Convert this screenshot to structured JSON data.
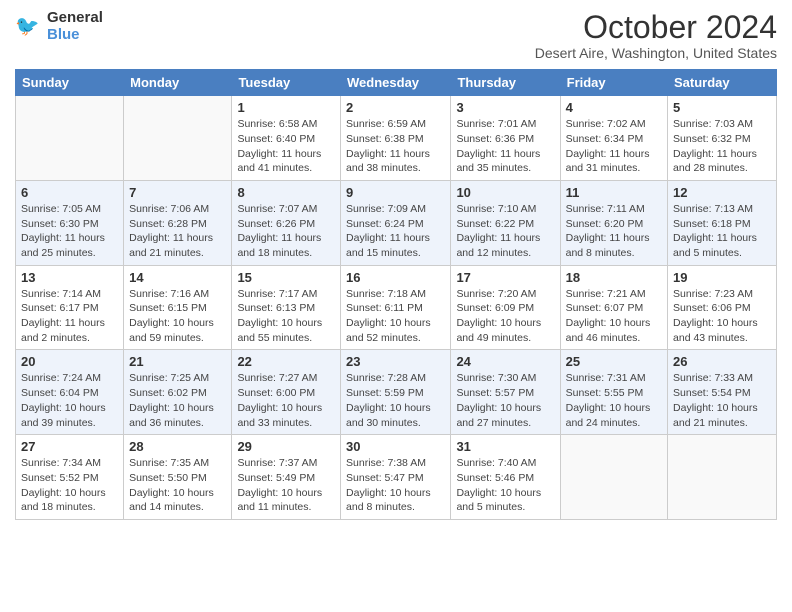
{
  "header": {
    "logo_line1": "General",
    "logo_line2": "Blue",
    "month": "October 2024",
    "location": "Desert Aire, Washington, United States"
  },
  "days_of_week": [
    "Sunday",
    "Monday",
    "Tuesday",
    "Wednesday",
    "Thursday",
    "Friday",
    "Saturday"
  ],
  "weeks": [
    [
      {
        "day": "",
        "info": ""
      },
      {
        "day": "",
        "info": ""
      },
      {
        "day": "1",
        "info": "Sunrise: 6:58 AM\nSunset: 6:40 PM\nDaylight: 11 hours and 41 minutes."
      },
      {
        "day": "2",
        "info": "Sunrise: 6:59 AM\nSunset: 6:38 PM\nDaylight: 11 hours and 38 minutes."
      },
      {
        "day": "3",
        "info": "Sunrise: 7:01 AM\nSunset: 6:36 PM\nDaylight: 11 hours and 35 minutes."
      },
      {
        "day": "4",
        "info": "Sunrise: 7:02 AM\nSunset: 6:34 PM\nDaylight: 11 hours and 31 minutes."
      },
      {
        "day": "5",
        "info": "Sunrise: 7:03 AM\nSunset: 6:32 PM\nDaylight: 11 hours and 28 minutes."
      }
    ],
    [
      {
        "day": "6",
        "info": "Sunrise: 7:05 AM\nSunset: 6:30 PM\nDaylight: 11 hours and 25 minutes."
      },
      {
        "day": "7",
        "info": "Sunrise: 7:06 AM\nSunset: 6:28 PM\nDaylight: 11 hours and 21 minutes."
      },
      {
        "day": "8",
        "info": "Sunrise: 7:07 AM\nSunset: 6:26 PM\nDaylight: 11 hours and 18 minutes."
      },
      {
        "day": "9",
        "info": "Sunrise: 7:09 AM\nSunset: 6:24 PM\nDaylight: 11 hours and 15 minutes."
      },
      {
        "day": "10",
        "info": "Sunrise: 7:10 AM\nSunset: 6:22 PM\nDaylight: 11 hours and 12 minutes."
      },
      {
        "day": "11",
        "info": "Sunrise: 7:11 AM\nSunset: 6:20 PM\nDaylight: 11 hours and 8 minutes."
      },
      {
        "day": "12",
        "info": "Sunrise: 7:13 AM\nSunset: 6:18 PM\nDaylight: 11 hours and 5 minutes."
      }
    ],
    [
      {
        "day": "13",
        "info": "Sunrise: 7:14 AM\nSunset: 6:17 PM\nDaylight: 11 hours and 2 minutes."
      },
      {
        "day": "14",
        "info": "Sunrise: 7:16 AM\nSunset: 6:15 PM\nDaylight: 10 hours and 59 minutes."
      },
      {
        "day": "15",
        "info": "Sunrise: 7:17 AM\nSunset: 6:13 PM\nDaylight: 10 hours and 55 minutes."
      },
      {
        "day": "16",
        "info": "Sunrise: 7:18 AM\nSunset: 6:11 PM\nDaylight: 10 hours and 52 minutes."
      },
      {
        "day": "17",
        "info": "Sunrise: 7:20 AM\nSunset: 6:09 PM\nDaylight: 10 hours and 49 minutes."
      },
      {
        "day": "18",
        "info": "Sunrise: 7:21 AM\nSunset: 6:07 PM\nDaylight: 10 hours and 46 minutes."
      },
      {
        "day": "19",
        "info": "Sunrise: 7:23 AM\nSunset: 6:06 PM\nDaylight: 10 hours and 43 minutes."
      }
    ],
    [
      {
        "day": "20",
        "info": "Sunrise: 7:24 AM\nSunset: 6:04 PM\nDaylight: 10 hours and 39 minutes."
      },
      {
        "day": "21",
        "info": "Sunrise: 7:25 AM\nSunset: 6:02 PM\nDaylight: 10 hours and 36 minutes."
      },
      {
        "day": "22",
        "info": "Sunrise: 7:27 AM\nSunset: 6:00 PM\nDaylight: 10 hours and 33 minutes."
      },
      {
        "day": "23",
        "info": "Sunrise: 7:28 AM\nSunset: 5:59 PM\nDaylight: 10 hours and 30 minutes."
      },
      {
        "day": "24",
        "info": "Sunrise: 7:30 AM\nSunset: 5:57 PM\nDaylight: 10 hours and 27 minutes."
      },
      {
        "day": "25",
        "info": "Sunrise: 7:31 AM\nSunset: 5:55 PM\nDaylight: 10 hours and 24 minutes."
      },
      {
        "day": "26",
        "info": "Sunrise: 7:33 AM\nSunset: 5:54 PM\nDaylight: 10 hours and 21 minutes."
      }
    ],
    [
      {
        "day": "27",
        "info": "Sunrise: 7:34 AM\nSunset: 5:52 PM\nDaylight: 10 hours and 18 minutes."
      },
      {
        "day": "28",
        "info": "Sunrise: 7:35 AM\nSunset: 5:50 PM\nDaylight: 10 hours and 14 minutes."
      },
      {
        "day": "29",
        "info": "Sunrise: 7:37 AM\nSunset: 5:49 PM\nDaylight: 10 hours and 11 minutes."
      },
      {
        "day": "30",
        "info": "Sunrise: 7:38 AM\nSunset: 5:47 PM\nDaylight: 10 hours and 8 minutes."
      },
      {
        "day": "31",
        "info": "Sunrise: 7:40 AM\nSunset: 5:46 PM\nDaylight: 10 hours and 5 minutes."
      },
      {
        "day": "",
        "info": ""
      },
      {
        "day": "",
        "info": ""
      }
    ]
  ]
}
